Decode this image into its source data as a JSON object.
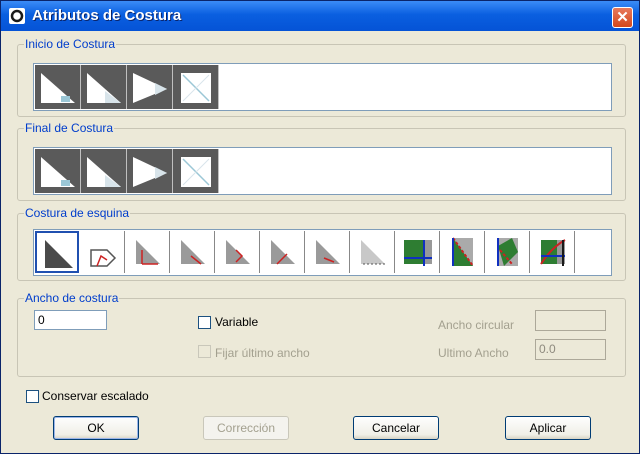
{
  "window": {
    "title": "Atributos de Costura",
    "close_icon": "close-icon",
    "app_icon": "app-ring-icon"
  },
  "groups": {
    "inicio": {
      "legend": "Inicio de Costura",
      "patterns": [
        "seam-start-pattern-1-icon",
        "seam-start-pattern-2-icon",
        "seam-start-pattern-3-icon",
        "seam-start-pattern-4-icon"
      ]
    },
    "final": {
      "legend": "Final de Costura",
      "patterns": [
        "seam-end-pattern-1-icon",
        "seam-end-pattern-2-icon",
        "seam-end-pattern-3-icon",
        "seam-end-pattern-4-icon"
      ]
    },
    "esquina": {
      "legend": "Costura de esquina",
      "selected_index": 0,
      "corners": [
        "corner-plain-icon",
        "corner-pivot-icon",
        "corner-square-icon",
        "corner-diagonal-icon",
        "corner-fold-icon",
        "corner-miter-icon",
        "corner-angle-icon",
        "corner-dotted-icon",
        "corner-green-t-icon",
        "corner-green-cross-icon",
        "corner-green-overlap-icon",
        "corner-green-arc-icon"
      ]
    },
    "ancho": {
      "legend": "Ancho de costura",
      "value": "0",
      "variable_label": "Variable",
      "fijar_label": "Fijar último ancho",
      "ancho_circular_label": "Ancho circular",
      "ancho_circular_value": "",
      "ultimo_ancho_label": "Ultimo Ancho",
      "ultimo_ancho_value": "0.0"
    }
  },
  "conservar_label": "Conservar escalado",
  "buttons": {
    "ok": "OK",
    "correccion": "Corrección",
    "cancelar": "Cancelar",
    "aplicar": "Aplicar"
  },
  "colors": {
    "title_bar": "#0a5fe0",
    "group_label": "#003dcc",
    "pattern_bg": "#5a5a5a",
    "corner_green": "#2e7d32"
  }
}
